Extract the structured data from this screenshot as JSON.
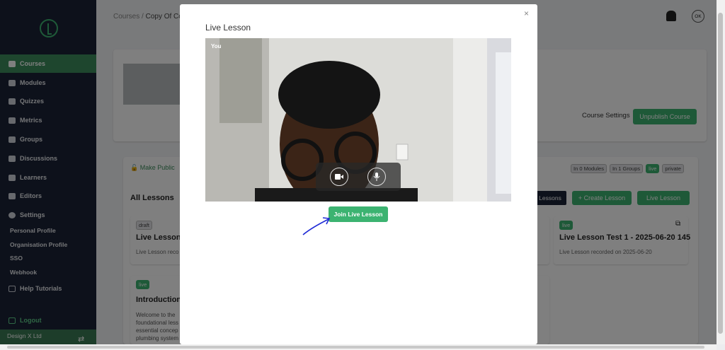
{
  "sidebar": {
    "items": [
      {
        "label": "Courses",
        "icon": "briefcase-icon",
        "active": true
      },
      {
        "label": "Modules",
        "icon": "grid-icon"
      },
      {
        "label": "Quizzes",
        "icon": "list-icon"
      },
      {
        "label": "Metrics",
        "icon": "pie-chart-icon"
      },
      {
        "label": "Groups",
        "icon": "groups-icon"
      },
      {
        "label": "Discussions",
        "icon": "chat-icon"
      },
      {
        "label": "Learners",
        "icon": "users-icon"
      },
      {
        "label": "Editors",
        "icon": "editor-icon"
      },
      {
        "label": "Settings",
        "icon": "gear-icon"
      }
    ],
    "sub_items": [
      "Personal Profile",
      "Organisation Profile",
      "SSO",
      "Webhook"
    ],
    "help": "Help Tutorials",
    "logout": "Logout",
    "org_name": "Design X Ltd"
  },
  "header": {
    "breadcrumb_root": "Courses",
    "breadcrumb_sep": "/",
    "breadcrumb_current": "Copy Of Co",
    "avatar": "OK"
  },
  "course": {
    "settings_label": "Course Settings",
    "unpublish_label": "Unpublish Course",
    "make_public": "Make Public",
    "tags": [
      "In 0 Modules",
      "In 1 Groups",
      "live",
      "private"
    ],
    "all_lessons": "All Lessons",
    "lessons_btn": "Lessons",
    "create_lesson": "+  Create Lesson",
    "live_lesson_btn": "Live Lesson"
  },
  "lessons": [
    {
      "badge": "draft",
      "title": "Live Lesson -",
      "desc": "Live Lesson reco"
    },
    {
      "badge": "live",
      "title": "Live Lesson Test 1 - 2025-06-20 145",
      "desc": "Live Lesson recorded on 2025-06-20"
    },
    {
      "badge": "live",
      "title": "Introduction t",
      "desc_lines": [
        "Welcome to the",
        "foundational less",
        "essential concep",
        "plumbing system"
      ]
    }
  ],
  "modal": {
    "title": "Live Lesson",
    "close": "×",
    "video_label": "You",
    "join_button": "Join Live Lesson"
  },
  "colors": {
    "sidebar_bg": "#1b2337",
    "accent_green": "#3cb371",
    "active_green": "#3c8d5c"
  }
}
